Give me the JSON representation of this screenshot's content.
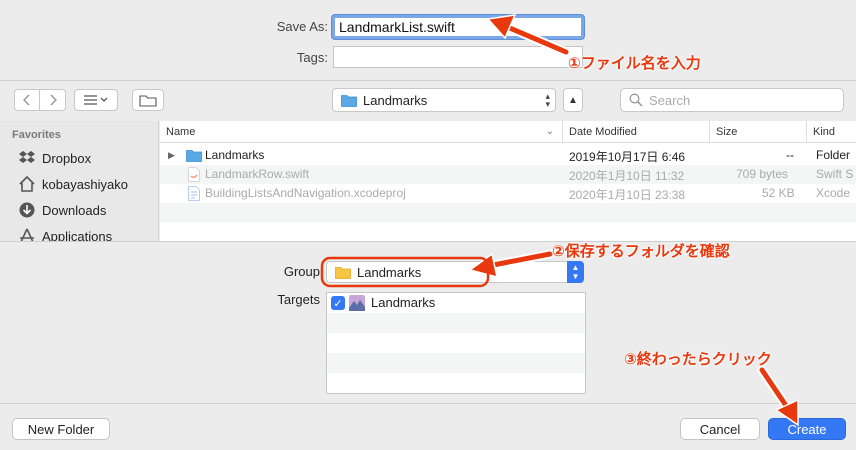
{
  "form": {
    "save_as_label": "Save As:",
    "save_as_value": "LandmarkList.swift",
    "tags_label": "Tags:",
    "tags_value": ""
  },
  "toolbar": {
    "location": "Landmarks",
    "search_placeholder": "Search"
  },
  "sidebar": {
    "heading": "Favorites",
    "items": [
      {
        "label": "Dropbox",
        "icon": "dropbox-icon"
      },
      {
        "label": "kobayashiyako",
        "icon": "home-icon"
      },
      {
        "label": "Downloads",
        "icon": "downloads-icon"
      },
      {
        "label": "Applications",
        "icon": "applications-icon"
      }
    ]
  },
  "files": {
    "columns": [
      "Name",
      "Date Modified",
      "Size",
      "Kind"
    ],
    "rows": [
      {
        "name": "Landmarks",
        "date": "2019年10月17日 6:46",
        "size": "--",
        "kind": "Folder",
        "dim": false,
        "icon": "folder-icon"
      },
      {
        "name": "LandmarkRow.swift",
        "date": "2020年1月10日 11:32",
        "size": "709 bytes",
        "kind": "Swift S",
        "dim": true,
        "icon": "swift-file-icon"
      },
      {
        "name": "BuildingListsAndNavigation.xcodeproj",
        "date": "2020年1月10日 23:38",
        "size": "52 KB",
        "kind": "Xcode",
        "dim": true,
        "icon": "xcodeproj-icon"
      }
    ]
  },
  "options": {
    "group_label": "Group",
    "group_value": "Landmarks",
    "targets_label": "Targets",
    "targets": [
      {
        "label": "Landmarks",
        "checked": true
      }
    ]
  },
  "buttons": {
    "new_folder": "New Folder",
    "cancel": "Cancel",
    "create": "Create"
  },
  "annotations": {
    "step1": "①ファイル名を入力",
    "step2": "②保存するフォルダを確認",
    "step3": "③終わったらクリック"
  },
  "colors": {
    "accent": "#3478f6",
    "annotation": "#e8380d"
  }
}
